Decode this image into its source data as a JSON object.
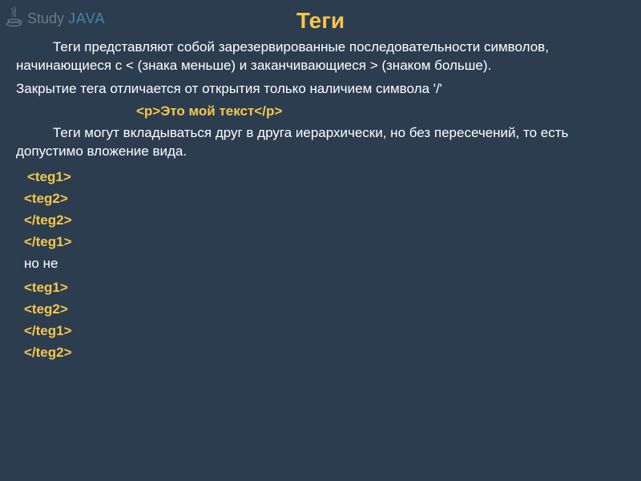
{
  "logo": {
    "study": "Study",
    "java": "JAVA"
  },
  "title": "Теги",
  "para1": "Теги представляют собой зарезервированные последовательности символов, начинающиеся с < (знака меньше) и заканчивающиеся > (знаком больше).",
  "para2": "Закрытие тега отличается от открытия только наличием символа '/'",
  "example": "<p>Это мой текст</p>",
  "para3": "Теги могут вкладываться друг в друга иерархически, но без пересечений, то есть допустимо вложение вида.",
  "nest": {
    "l1": "<teg1>",
    "l2": "<teg2>",
    "l3": "</teg2>",
    "l4": "</teg1>"
  },
  "butnot": "но не",
  "bad": {
    "l1": "<teg1>",
    "l2": "<teg2>",
    "l3": "</teg1>",
    "l4": "</teg2>"
  }
}
